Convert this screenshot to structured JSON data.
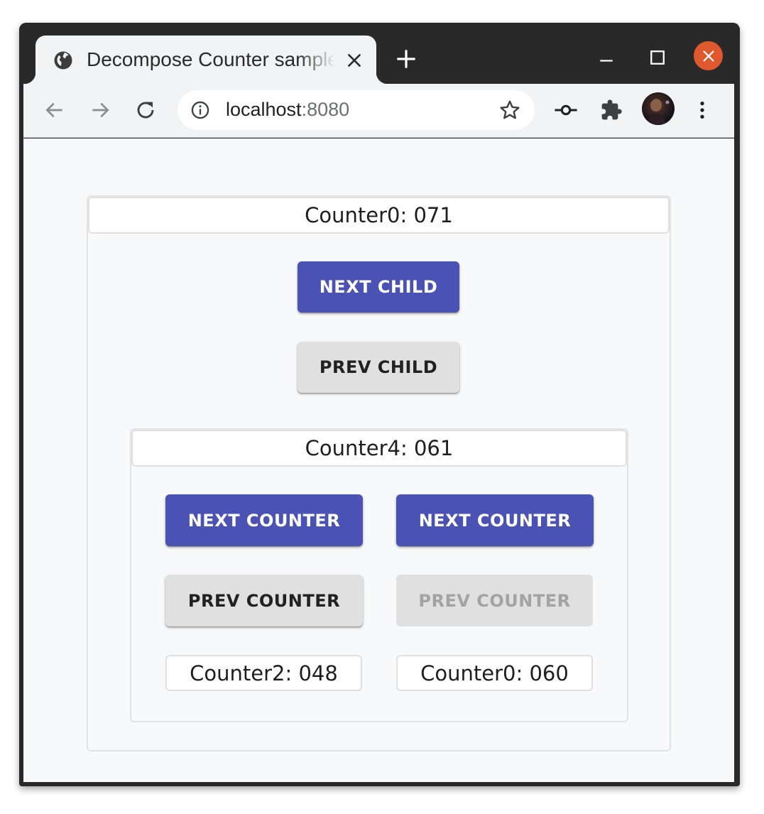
{
  "browser": {
    "tab": {
      "title": "Decompose Counter sample",
      "favicon": "globe-icon",
      "close_icon": "close-icon"
    },
    "new_tab_icon": "plus-icon",
    "window_controls": [
      "minimize-icon",
      "maximize-icon",
      "close-icon"
    ],
    "nav": [
      "back-arrow-icon",
      "forward-arrow-icon",
      "reload-icon"
    ],
    "address": {
      "host": "localhost",
      "port": ":8080",
      "info_icon": "info-icon",
      "star_icon": "star-icon"
    },
    "toolbar_icons": [
      "commit-icon",
      "extensions-puzzle-icon",
      "profile-avatar",
      "more-vert-icon"
    ]
  },
  "colors": {
    "primary_button": "#4a52b3",
    "secondary_button": "#e0e0e0",
    "disabled_text": "#a3a3a3",
    "window_close": "#e0582d"
  },
  "root": {
    "counter_label": "Counter0: 071",
    "next_child_label": "NEXT CHILD",
    "prev_child_label": "PREV CHILD",
    "child": {
      "counter_label": "Counter4: 061",
      "left": {
        "next_label": "NEXT COUNTER",
        "prev_label": "PREV COUNTER",
        "prev_enabled": true,
        "counter_label": "Counter2: 048"
      },
      "right": {
        "next_label": "NEXT COUNTER",
        "prev_label": "PREV COUNTER",
        "prev_enabled": false,
        "counter_label": "Counter0: 060"
      }
    }
  }
}
